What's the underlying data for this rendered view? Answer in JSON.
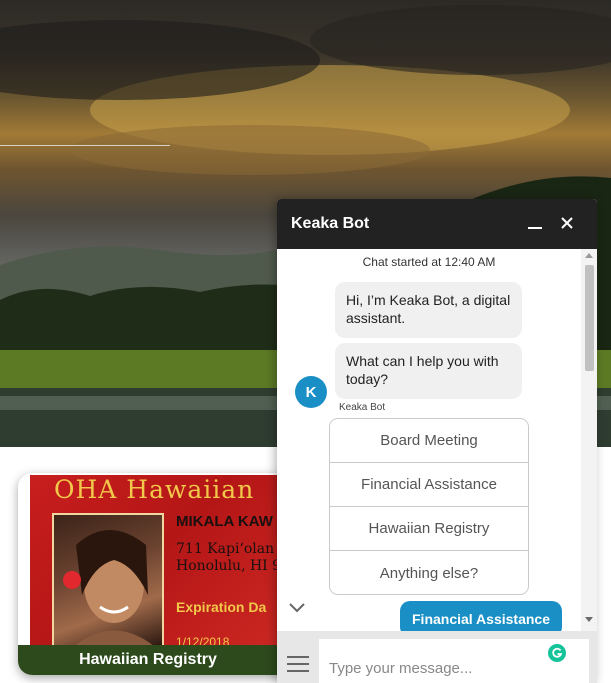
{
  "colors": {
    "chat_header_bg": "#222222",
    "accent_blue": "#1a8fc6",
    "card_red": "#c81e1e",
    "card_green": "#2d4a1c"
  },
  "card": {
    "title": "OHA Hawaiian",
    "name": "MIKALA KAW",
    "address": "711 Kapiʻolan\nHonolulu, HI 9",
    "expiration_label": "Expiration Da",
    "date": "1/12/2018",
    "footer": "Hawaiian Registry"
  },
  "chat": {
    "title": "Keaka Bot",
    "minimize_icon": "minimize-icon",
    "close_icon": "close-icon",
    "started": "Chat started at 12:40 AM",
    "messages": [
      {
        "text": "Hi, I’m Keaka Bot, a digital assistant."
      },
      {
        "text": "What can I help you with today?"
      }
    ],
    "avatar_letter": "K",
    "bot_label": "Keaka Bot",
    "options": [
      "Board Meeting",
      "Financial Assistance",
      "Hawaiian Registry",
      "Anything else?"
    ],
    "user_reply": "Financial Assistance",
    "input_placeholder": "Type your message..."
  }
}
